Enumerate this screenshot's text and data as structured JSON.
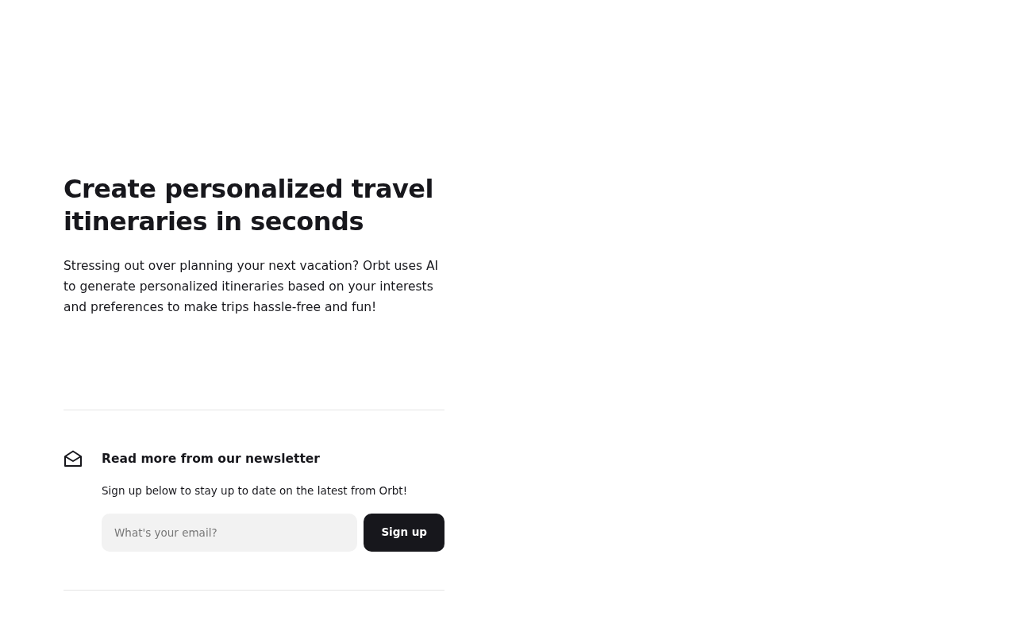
{
  "hero": {
    "title": "Create personalized travel itineraries in seconds",
    "description": "Stressing out over planning your next vacation? Orbt uses AI to generate personalized itineraries based on your interests and preferences to make trips hassle-free and fun!"
  },
  "newsletter": {
    "heading": "Read more from our newsletter",
    "text": "Sign up below to stay up to date on the latest from Orbt!",
    "email": {
      "placeholder": "What's your email?"
    },
    "button": "Sign up"
  }
}
